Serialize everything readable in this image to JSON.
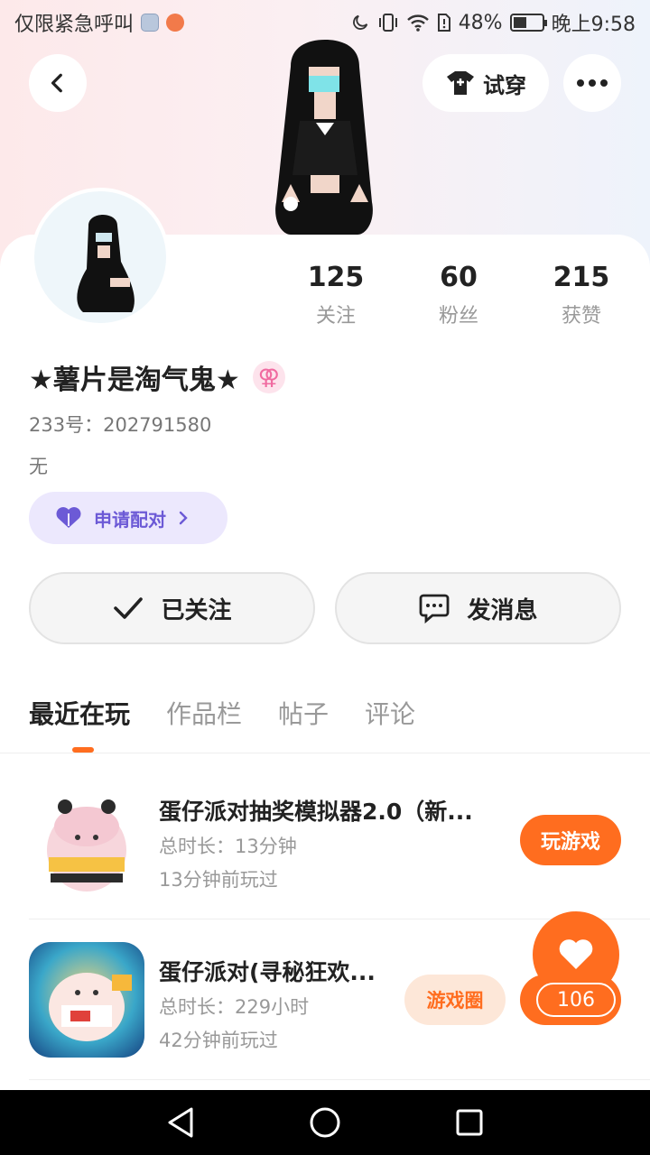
{
  "status_bar": {
    "left_text": "仅限紧急呼叫",
    "battery": "48%",
    "battery_level": 0.48,
    "time": "晚上9:58"
  },
  "header": {
    "tryon_label": "试穿"
  },
  "profile": {
    "stats": [
      {
        "value": "125",
        "label": "关注"
      },
      {
        "value": "60",
        "label": "粉丝"
      },
      {
        "value": "215",
        "label": "获赞"
      }
    ],
    "username": "★薯片是淘气鬼★",
    "gender_symbol": "⚢",
    "uid_label": "233号：",
    "uid": "202791580",
    "bio": "无",
    "match_label": "申请配对"
  },
  "actions": {
    "follow_label": "已关注",
    "message_label": "发消息"
  },
  "tabs": [
    {
      "label": "最近在玩",
      "active": true
    },
    {
      "label": "作品栏",
      "active": false
    },
    {
      "label": "帖子",
      "active": false
    },
    {
      "label": "评论",
      "active": false
    }
  ],
  "games": [
    {
      "title": "蛋仔派对抽奖模拟器2.0（新...",
      "duration": "总时长：13分钟",
      "last_played": "13分钟前玩过",
      "button": "玩游戏"
    },
    {
      "title": "蛋仔派对(寻秘狂欢...",
      "duration": "总时长：229小时",
      "last_played": "42分钟前玩过",
      "tag": "游戏圈"
    }
  ],
  "like": {
    "count": "106"
  },
  "colors": {
    "accent": "#ff6d1f",
    "match": "#6c5ad6",
    "match_bg": "#ece8fd"
  }
}
